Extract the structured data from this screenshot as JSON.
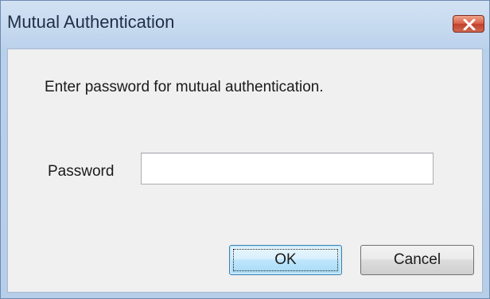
{
  "window": {
    "title": "Mutual Authentication",
    "close_icon": "close-icon"
  },
  "dialog": {
    "prompt": "Enter password for mutual authentication.",
    "password_label": "Password",
    "password_value": "",
    "password_placeholder": ""
  },
  "buttons": {
    "ok_label": "OK",
    "cancel_label": "Cancel"
  },
  "colors": {
    "title_bar": "#bcd2ec",
    "client_background": "#f0f0f0",
    "close_button": "#c1402b",
    "default_button_border": "#3c7fb1"
  }
}
